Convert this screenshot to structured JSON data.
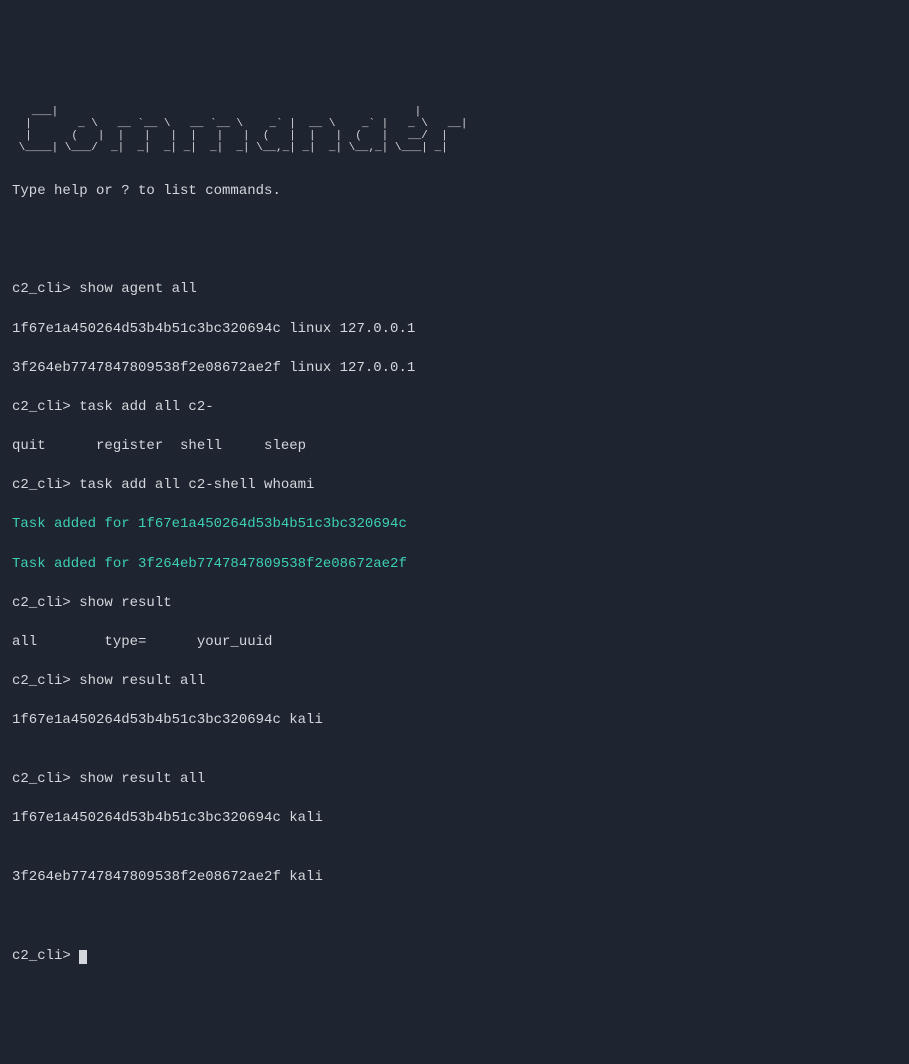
{
  "ascii_banner": "   ___|                                                      |              \n  |       _ \\   __ `__ \\   __ `__ \\    _` |  __ \\    _` |   _ \\   __|  \n  |      (   |  |   |   |  |   |   |  (   |  |   |  (   |   __/  |     \n \\____| \\___/  _|  _|  _| _|  _|  _| \\__,_| _|  _| \\__,_| \\___| _|    ",
  "faint_lines": {
    "top_left": "  ",
    "item1": "",
    "item2": "",
    "item3": ""
  },
  "help_text": "Type help or ? to list commands.",
  "session": {
    "prompt": "c2_cli>",
    "lines": [
      {
        "type": "cmd",
        "text": "c2_cli> show agent all"
      },
      {
        "type": "out",
        "text": "1f67e1a450264d53b4b51c3bc320694c linux 127.0.0.1"
      },
      {
        "type": "out",
        "text": "3f264eb7747847809538f2e08672ae2f linux 127.0.0.1"
      },
      {
        "type": "cmd",
        "text": "c2_cli> task add all c2-"
      },
      {
        "type": "out",
        "text": "quit      register  shell     sleep"
      },
      {
        "type": "cmd",
        "text": "c2_cli> task add all c2-shell whoami"
      },
      {
        "type": "success",
        "text": "Task added for 1f67e1a450264d53b4b51c3bc320694c"
      },
      {
        "type": "success",
        "text": "Task added for 3f264eb7747847809538f2e08672ae2f"
      },
      {
        "type": "cmd",
        "text": "c2_cli> show result"
      },
      {
        "type": "out",
        "text": "all        type=      your_uuid"
      },
      {
        "type": "cmd",
        "text": "c2_cli> show result all"
      },
      {
        "type": "out",
        "text": "1f67e1a450264d53b4b51c3bc320694c kali"
      },
      {
        "type": "blank",
        "text": ""
      },
      {
        "type": "cmd",
        "text": "c2_cli> show result all"
      },
      {
        "type": "out",
        "text": "1f67e1a450264d53b4b51c3bc320694c kali"
      },
      {
        "type": "blank",
        "text": ""
      },
      {
        "type": "out",
        "text": "3f264eb7747847809538f2e08672ae2f kali"
      },
      {
        "type": "blank",
        "text": ""
      }
    ],
    "final_prompt": "c2_cli> "
  }
}
